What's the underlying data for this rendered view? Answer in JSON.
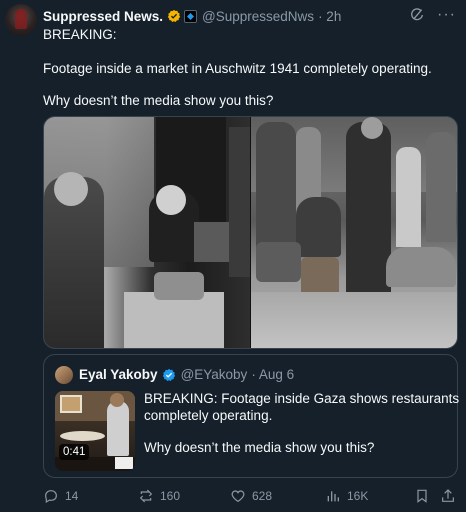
{
  "post": {
    "author": "Suppressed News.",
    "handle": "@SuppressedNws",
    "time": "· 2h",
    "line1": "BREAKING:",
    "line2": "Footage inside a market in Auschwitz 1941 completely operating.",
    "line3": "Why doesn’t the media show you this?"
  },
  "quoted": {
    "author": "Eyal Yakoby",
    "handle": "@EYakoby",
    "time": "· Aug 6",
    "line1": "BREAKING: Footage inside Gaza shows restaurants",
    "line2": "completely operating.",
    "line3": "Why doesn’t the media show you this?",
    "duration": "0:41"
  },
  "actions": {
    "replies": "14",
    "reposts": "160",
    "likes": "628",
    "views": "16K"
  },
  "icons": {
    "verified": "verified-badge-icon",
    "grok": "grok-icon",
    "more": "more-icon",
    "reply": "reply-icon",
    "repost": "repost-icon",
    "like": "like-icon",
    "views": "views-icon",
    "bookmark": "bookmark-icon",
    "share": "share-icon"
  },
  "colors": {
    "background": "#15202b",
    "text": "#f7f9f9",
    "muted": "#8b98a5",
    "verified": "#1d9bf0",
    "gold": "#f4b400",
    "border": "#38444d"
  }
}
